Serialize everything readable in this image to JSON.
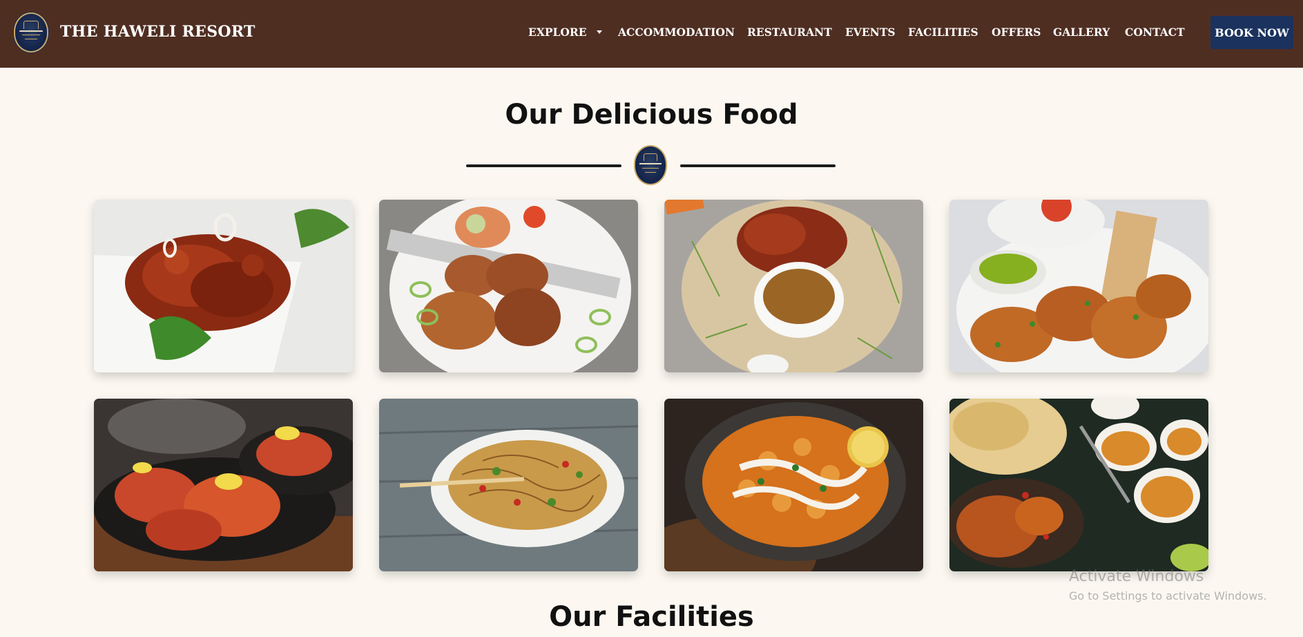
{
  "header": {
    "brand": "THE HAWELI RESORT",
    "nav": [
      "EXPLORE",
      "ACCOMMODATION",
      "RESTAURANT",
      "EVENTS",
      "FACILITIES",
      "OFFERS",
      "GALLERY",
      "CONTACT"
    ],
    "book_label": "BOOK NOW",
    "colors": {
      "header_bg": "#4f2e22",
      "button_bg": "#1a325d"
    }
  },
  "food_section": {
    "title": "Our Delicious Food",
    "images": [
      "chilli-chicken-dish",
      "grilled-chicken-tikka-platter",
      "biryani-with-gravy",
      "pakora-with-green-chutney",
      "sizzling-tandoori-platter",
      "hakka-noodles-bowl",
      "paneer-curry-kadai",
      "naan-and-curry-spread"
    ]
  },
  "next_section": {
    "title": "Our Facilities"
  },
  "watermark": {
    "title": "Activate Windows",
    "subtitle": "Go to Settings to activate Windows."
  }
}
